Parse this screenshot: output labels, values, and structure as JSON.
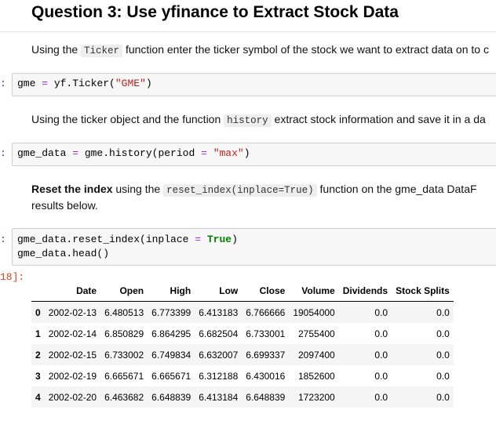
{
  "heading": "Question 3: Use yfinance to Extract Stock Data",
  "md1": {
    "pre": "Using the ",
    "code": "Ticker",
    "post": " function enter the ticker symbol of the stock we want to extract data on to c"
  },
  "cell1": {
    "prompt": ":",
    "line": {
      "a": "gme ",
      "op": "=",
      "b": " yf.Ticker(",
      "s": "\"GME\"",
      "c": ")"
    }
  },
  "md2": {
    "pre": "Using the ticker object and the function ",
    "code": "history",
    "post": " extract stock information and save it in a da"
  },
  "cell2": {
    "prompt": ":",
    "line": {
      "a": "gme_data ",
      "op": "=",
      "b": " gme.history(period ",
      "op2": "=",
      "c": " ",
      "s": "\"max\"",
      "d": ")"
    }
  },
  "md3": {
    "bold": "Reset the index",
    "pre": " using the ",
    "code": "reset_index(inplace=True)",
    "post": " function on the gme_data DataF",
    "line2": "results below."
  },
  "cell3": {
    "prompt": ":",
    "line1": {
      "a": "gme_data.reset_index(inplace ",
      "op": "=",
      "b": " ",
      "kw": "True",
      "c": ")"
    },
    "line2": "gme_data.head()"
  },
  "out_prompt": "18]:",
  "table": {
    "columns": [
      "",
      "Date",
      "Open",
      "High",
      "Low",
      "Close",
      "Volume",
      "Dividends",
      "Stock Splits"
    ],
    "rows": [
      [
        "0",
        "2002-02-13",
        "6.480513",
        "6.773399",
        "6.413183",
        "6.766666",
        "19054000",
        "0.0",
        "0.0"
      ],
      [
        "1",
        "2002-02-14",
        "6.850829",
        "6.864295",
        "6.682504",
        "6.733001",
        "2755400",
        "0.0",
        "0.0"
      ],
      [
        "2",
        "2002-02-15",
        "6.733002",
        "6.749834",
        "6.632007",
        "6.699337",
        "2097400",
        "0.0",
        "0.0"
      ],
      [
        "3",
        "2002-02-19",
        "6.665671",
        "6.665671",
        "6.312188",
        "6.430016",
        "1852600",
        "0.0",
        "0.0"
      ],
      [
        "4",
        "2002-02-20",
        "6.463682",
        "6.648839",
        "6.413184",
        "6.648839",
        "1723200",
        "0.0",
        "0.0"
      ]
    ]
  }
}
